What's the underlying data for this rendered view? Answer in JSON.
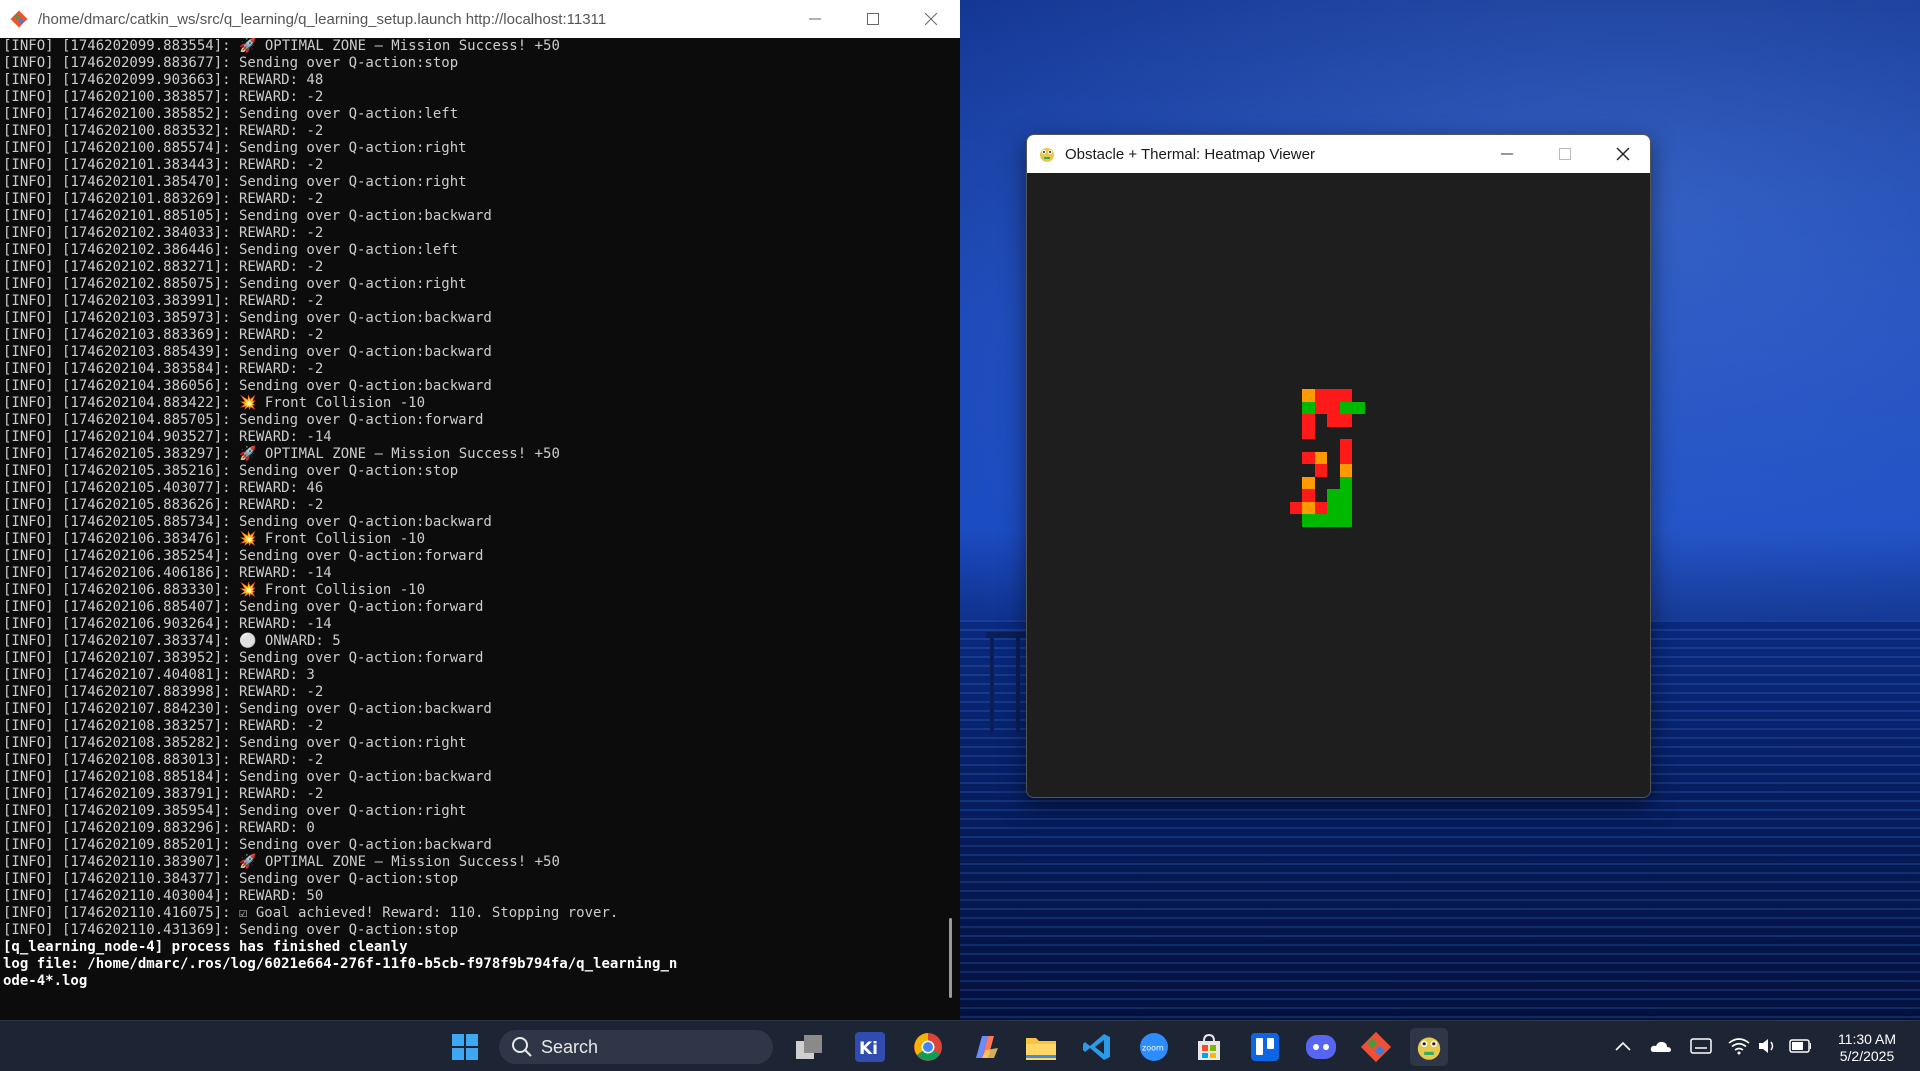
{
  "terminal": {
    "title": "/home/dmarc/catkin_ws/src/q_learning/q_learning_setup.launch http://localhost:11311",
    "lines": [
      "[INFO] [1746202099.883554]: 🚀 OPTIMAL ZONE – Mission Success! +50",
      "[INFO] [1746202099.883677]: Sending over Q-action:stop",
      "[INFO] [1746202099.903663]: REWARD: 48",
      "[INFO] [1746202100.383857]: REWARD: -2",
      "[INFO] [1746202100.385852]: Sending over Q-action:left",
      "[INFO] [1746202100.883532]: REWARD: -2",
      "[INFO] [1746202100.885574]: Sending over Q-action:right",
      "[INFO] [1746202101.383443]: REWARD: -2",
      "[INFO] [1746202101.385470]: Sending over Q-action:right",
      "[INFO] [1746202101.883269]: REWARD: -2",
      "[INFO] [1746202101.885105]: Sending over Q-action:backward",
      "[INFO] [1746202102.384033]: REWARD: -2",
      "[INFO] [1746202102.386446]: Sending over Q-action:left",
      "[INFO] [1746202102.883271]: REWARD: -2",
      "[INFO] [1746202102.885075]: Sending over Q-action:right",
      "[INFO] [1746202103.383991]: REWARD: -2",
      "[INFO] [1746202103.385973]: Sending over Q-action:backward",
      "[INFO] [1746202103.883369]: REWARD: -2",
      "[INFO] [1746202103.885439]: Sending over Q-action:backward",
      "[INFO] [1746202104.383584]: REWARD: -2",
      "[INFO] [1746202104.386056]: Sending over Q-action:backward",
      "[INFO] [1746202104.883422]: 💥 Front Collision -10",
      "[INFO] [1746202104.885705]: Sending over Q-action:forward",
      "[INFO] [1746202104.903527]: REWARD: -14",
      "[INFO] [1746202105.383297]: 🚀 OPTIMAL ZONE – Mission Success! +50",
      "[INFO] [1746202105.385216]: Sending over Q-action:stop",
      "[INFO] [1746202105.403077]: REWARD: 46",
      "[INFO] [1746202105.883626]: REWARD: -2",
      "[INFO] [1746202105.885734]: Sending over Q-action:backward",
      "[INFO] [1746202106.383476]: 💥 Front Collision -10",
      "[INFO] [1746202106.385254]: Sending over Q-action:forward",
      "[INFO] [1746202106.406186]: REWARD: -14",
      "[INFO] [1746202106.883330]: 💥 Front Collision -10",
      "[INFO] [1746202106.885407]: Sending over Q-action:forward",
      "[INFO] [1746202106.903264]: REWARD: -14",
      "[INFO] [1746202107.383374]: ⚪ ONWARD: 5",
      "[INFO] [1746202107.383952]: Sending over Q-action:forward",
      "[INFO] [1746202107.404081]: REWARD: 3",
      "[INFO] [1746202107.883998]: REWARD: -2",
      "[INFO] [1746202107.884230]: Sending over Q-action:backward",
      "[INFO] [1746202108.383257]: REWARD: -2",
      "[INFO] [1746202108.385282]: Sending over Q-action:right",
      "[INFO] [1746202108.883013]: REWARD: -2",
      "[INFO] [1746202108.885184]: Sending over Q-action:backward",
      "[INFO] [1746202109.383791]: REWARD: -2",
      "[INFO] [1746202109.385954]: Sending over Q-action:right",
      "[INFO] [1746202109.883296]: REWARD: 0",
      "[INFO] [1746202109.885201]: Sending over Q-action:backward",
      "[INFO] [1746202110.383907]: 🚀 OPTIMAL ZONE – Mission Success! +50",
      "[INFO] [1746202110.384377]: Sending over Q-action:stop",
      "[INFO] [1746202110.403004]: REWARD: 50",
      "[INFO] [1746202110.416075]: ☑ Goal achieved! Reward: 110. Stopping rover.",
      "[INFO] [1746202110.431369]: Sending over Q-action:stop"
    ],
    "final_lines": [
      "[q_learning_node-4] process has finished cleanly",
      "log file: /home/dmarc/.ros/log/6021e664-276f-11f0-b5cb-f978f9b794fa/q_learning_n",
      "ode-4*.log"
    ]
  },
  "viewer": {
    "title": "Obstacle + Thermal: Heatmap Viewer",
    "colors": {
      "red": "#ff1a1a",
      "orange": "#ff9900",
      "green": "#00b800"
    },
    "cells": [
      {
        "c": 0,
        "r": 0,
        "v": "orange"
      },
      {
        "c": 1,
        "r": 0,
        "v": "red"
      },
      {
        "c": 2,
        "r": 0,
        "v": "red"
      },
      {
        "c": 3,
        "r": 0,
        "v": "red"
      },
      {
        "c": 0,
        "r": 1,
        "v": "green"
      },
      {
        "c": 1,
        "r": 1,
        "v": "red"
      },
      {
        "c": 2,
        "r": 1,
        "v": "red"
      },
      {
        "c": 3,
        "r": 1,
        "v": "green"
      },
      {
        "c": 4,
        "r": 1,
        "v": "green"
      },
      {
        "c": 0,
        "r": 2,
        "v": "red"
      },
      {
        "c": 2,
        "r": 2,
        "v": "red"
      },
      {
        "c": 3,
        "r": 2,
        "v": "red"
      },
      {
        "c": 0,
        "r": 3,
        "v": "red"
      },
      {
        "c": 3,
        "r": 4,
        "v": "red"
      },
      {
        "c": 0,
        "r": 5,
        "v": "red"
      },
      {
        "c": 1,
        "r": 5,
        "v": "orange"
      },
      {
        "c": 3,
        "r": 5,
        "v": "red"
      },
      {
        "c": 1,
        "r": 6,
        "v": "red"
      },
      {
        "c": 3,
        "r": 6,
        "v": "orange"
      },
      {
        "c": 0,
        "r": 7,
        "v": "orange"
      },
      {
        "c": 3,
        "r": 7,
        "v": "green"
      },
      {
        "c": 0,
        "r": 8,
        "v": "red"
      },
      {
        "c": 2,
        "r": 8,
        "v": "green"
      },
      {
        "c": 3,
        "r": 8,
        "v": "green"
      },
      {
        "c": -1,
        "r": 9,
        "v": "red"
      },
      {
        "c": 0,
        "r": 9,
        "v": "orange"
      },
      {
        "c": 1,
        "r": 9,
        "v": "red"
      },
      {
        "c": 2,
        "r": 9,
        "v": "green"
      },
      {
        "c": 3,
        "r": 9,
        "v": "green"
      },
      {
        "c": 0,
        "r": 10,
        "v": "green"
      },
      {
        "c": 1,
        "r": 10,
        "v": "green"
      },
      {
        "c": 2,
        "r": 10,
        "v": "green"
      },
      {
        "c": 3,
        "r": 10,
        "v": "green"
      }
    ]
  },
  "taskbar": {
    "search_label": "Search",
    "apps": [
      "start-icon",
      "task-view-icon",
      "kicad-icon",
      "chrome-icon",
      "copilot-icon",
      "file-explorer-icon",
      "vscode-icon",
      "zoom-icon",
      "ms-store-icon",
      "trello-icon",
      "discord-icon",
      "git-icon",
      "python-icon"
    ],
    "zoom_label": "zoom",
    "tray": [
      "chevron-up-icon",
      "onedrive-icon",
      "keyboard-icon",
      "wifi-icon",
      "volume-icon",
      "battery-icon"
    ],
    "time": "11:30 AM",
    "date": "5/2/2025"
  }
}
